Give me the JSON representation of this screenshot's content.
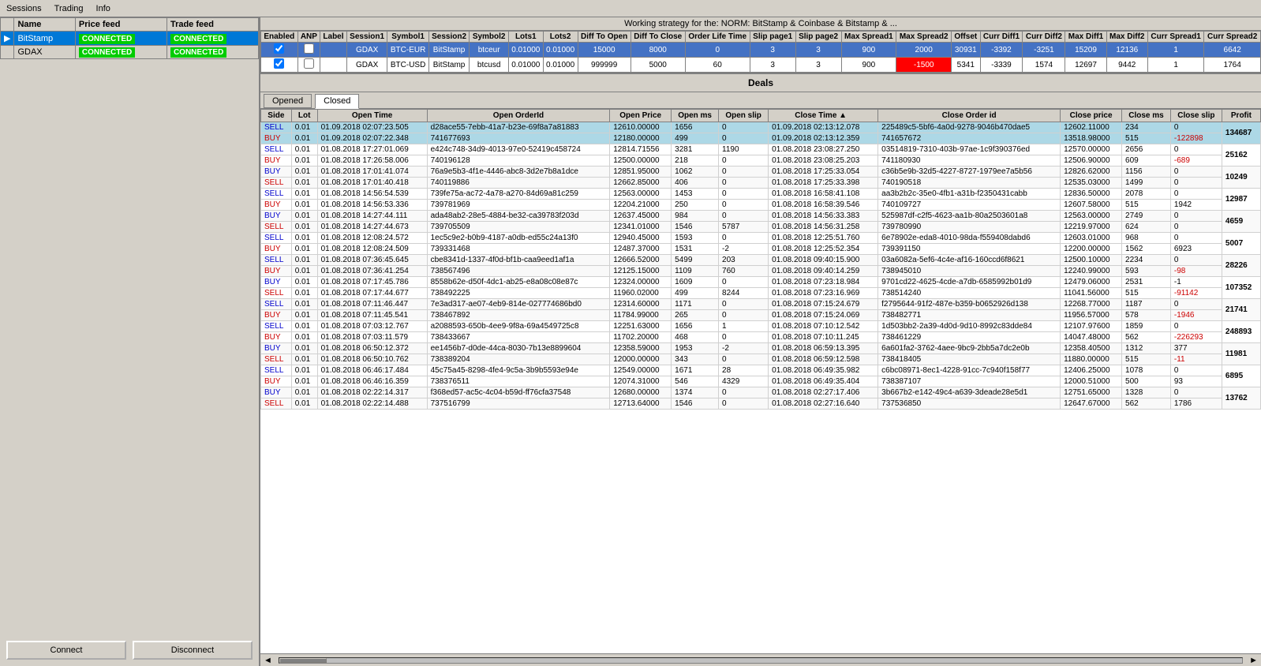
{
  "menu": {
    "items": [
      "Sessions",
      "Trading",
      "Info"
    ]
  },
  "title": "Working strategy for the: NORM: BitStamp & Coinbase & Bitstamp & ...",
  "leftPanel": {
    "columns": [
      "Name",
      "Price feed",
      "Trade feed"
    ],
    "rows": [
      {
        "name": "BitStamp",
        "priceFeed": "CONNECTED",
        "tradeFeed": "CONNECTED",
        "selected": true
      },
      {
        "name": "GDAX",
        "priceFeed": "CONNECTED",
        "tradeFeed": "CONNECTED",
        "selected": false
      }
    ],
    "connectBtn": "Connect",
    "disconnectBtn": "Disconnect"
  },
  "arbTable": {
    "columns": [
      "Enabled",
      "ANP",
      "Label",
      "Session1",
      "Symbol1",
      "Session2",
      "Symbol2",
      "Lots1",
      "Lots2",
      "Diff To Open",
      "Diff To Close",
      "Order Life Time",
      "Slip page1",
      "Slip page2",
      "Max Spread1",
      "Max Spread2",
      "Offset",
      "Curr Diff1",
      "Curr Diff2",
      "Max Diff1",
      "Max Diff2",
      "Curr Spread1",
      "Curr Spread2"
    ],
    "rows": [
      {
        "enabled": true,
        "anp": false,
        "label": "",
        "session1": "GDAX",
        "symbol1": "BTC-EUR",
        "session2": "BitStamp",
        "symbol2": "btceur",
        "lots1": "0.01000",
        "lots2": "0.01000",
        "diffOpen": "15000",
        "diffClose": "8000",
        "lifeTime": "0",
        "slip1": "3",
        "slip2": "3",
        "maxSpread1": "900",
        "maxSpread2": "2000",
        "offset": "30931",
        "currDiff1": "-3392",
        "currDiff2": "-3251",
        "maxDiff1": "15209",
        "maxDiff2": "12136",
        "currSpread1": "1",
        "currSpread2": "6642",
        "rowClass": "row-blue"
      },
      {
        "enabled": true,
        "anp": false,
        "label": "",
        "session1": "GDAX",
        "symbol1": "BTC-USD",
        "session2": "BitStamp",
        "symbol2": "btcusd",
        "lots1": "0.01000",
        "lots2": "0.01000",
        "diffOpen": "999999",
        "diffClose": "5000",
        "lifeTime": "60",
        "slip1": "3",
        "slip2": "3",
        "maxSpread1": "900",
        "maxSpread2": "-1500",
        "offset": "5341",
        "currDiff1": "-3339",
        "currDiff2": "1574",
        "maxDiff1": "12697",
        "maxDiff2": "9442",
        "currSpread1": "1",
        "currSpread2": "1764",
        "rowClass": "row-white",
        "redCell": "maxSpread2"
      }
    ]
  },
  "deals": {
    "title": "Deals",
    "tabs": [
      "Opened",
      "Closed"
    ],
    "activeTab": "Closed",
    "columns": [
      "Side",
      "Lot",
      "Open Time",
      "Open OrderId",
      "Open Price",
      "Open ms",
      "Open slip",
      "Close Time",
      "Close Order id",
      "Close price",
      "Close ms",
      "Close slip",
      "Profit"
    ],
    "rows": [
      {
        "side1": "SELL",
        "side2": "BUY",
        "lot1": "0.01",
        "lot2": "0.01",
        "openTime1": "01.09.2018 02:07:23.505",
        "openTime2": "01.09.2018 02:07:22.348",
        "orderId1": "d28ace55-7ebb-41a7-b23e-69f8a7a81883",
        "orderId2": "741677693",
        "openPrice1": "12610.00000",
        "openPrice2": "12180.00000",
        "openMs1": "1656",
        "openMs2": "499",
        "openSlip1": "0",
        "openSlip2": "0",
        "closeTime1": "01.09.2018 02:13:12.078",
        "closeTime2": "01.09.2018 02:13:12.359",
        "closeOrderId1": "225489c5-5bf6-4a0d-9278-9046b470dae5",
        "closeOrderId2": "741657672",
        "closePrice1": "12602.11000",
        "closePrice2": "13518.98000",
        "closeMs1": "234",
        "closeMs2": "515",
        "closeSlip1": "0",
        "closeSlip2": "-122898",
        "profit": "134687",
        "highlight": true
      },
      {
        "side1": "SELL",
        "side2": "BUY",
        "lot1": "0.01",
        "lot2": "0.01",
        "openTime1": "01.08.2018 17:27:01.069",
        "openTime2": "01.08.2018 17:26:58.006",
        "orderId1": "e424c748-34d9-4013-97e0-52419c458724",
        "orderId2": "740196128",
        "openPrice1": "12814.71556",
        "openPrice2": "12500.00000",
        "openMs1": "3281",
        "openMs2": "218",
        "openSlip1": "1190",
        "openSlip2": "0",
        "closeTime1": "01.08.2018 23:08:27.250",
        "closeTime2": "01.08.2018 23:08:25.203",
        "closeOrderId1": "03514819-7310-403b-97ae-1c9f390376ed",
        "closeOrderId2": "741180930",
        "closePrice1": "12570.00000",
        "closePrice2": "12506.90000",
        "closeMs1": "2656",
        "closeMs2": "609",
        "closeSlip1": "0",
        "closeSlip2": "-689",
        "profit": "25162",
        "highlight": false
      },
      {
        "side1": "BUY",
        "side2": "SELL",
        "lot1": "0.01",
        "lot2": "0.01",
        "openTime1": "01.08.2018 17:01:41.074",
        "openTime2": "01.08.2018 17:01:40.418",
        "orderId1": "76a9e5b3-4f1e-4446-abc8-3d2e7b8a1dce",
        "orderId2": "740119886",
        "openPrice1": "12851.95000",
        "openPrice2": "12662.85000",
        "openMs1": "1062",
        "openMs2": "406",
        "openSlip1": "0",
        "openSlip2": "0",
        "closeTime1": "01.08.2018 17:25:33.054",
        "closeTime2": "01.08.2018 17:25:33.398",
        "closeOrderId1": "c36b5e9b-32d5-4227-8727-1979ee7a5b56",
        "closeOrderId2": "740190518",
        "closePrice1": "12826.62000",
        "closePrice2": "12535.03000",
        "closeMs1": "1156",
        "closeMs2": "1499",
        "closeSlip1": "0",
        "closeSlip2": "0",
        "profit": "10249",
        "highlight": false
      },
      {
        "side1": "SELL",
        "side2": "BUY",
        "lot1": "0.01",
        "lot2": "0.01",
        "openTime1": "01.08.2018 14:56:54.539",
        "openTime2": "01.08.2018 14:56:53.336",
        "orderId1": "739fe75a-ac72-4a78-a270-84d69a81c259",
        "orderId2": "739781969",
        "openPrice1": "12563.00000",
        "openPrice2": "12204.21000",
        "openMs1": "1453",
        "openMs2": "250",
        "openSlip1": "0",
        "openSlip2": "0",
        "closeTime1": "01.08.2018 16:58:41.108",
        "closeTime2": "01.08.2018 16:58:39.546",
        "closeOrderId1": "aa3b2b2c-35e0-4fb1-a31b-f2350431cabb",
        "closeOrderId2": "740109727",
        "closePrice1": "12836.50000",
        "closePrice2": "12607.58000",
        "closeMs1": "2078",
        "closeMs2": "515",
        "closeSlip1": "0",
        "closeSlip2": "1942",
        "profit": "12987",
        "highlight": false
      },
      {
        "side1": "BUY",
        "side2": "SELL",
        "lot1": "0.01",
        "lot2": "0.01",
        "openTime1": "01.08.2018 14:27:44.111",
        "openTime2": "01.08.2018 14:27:44.673",
        "orderId1": "ada48ab2-28e5-4884-be32-ca39783f203d",
        "orderId2": "739705509",
        "openPrice1": "12637.45000",
        "openPrice2": "12341.01000",
        "openMs1": "984",
        "openMs2": "1546",
        "openSlip1": "0",
        "openSlip2": "5787",
        "closeTime1": "01.08.2018 14:56:33.383",
        "closeTime2": "01.08.2018 14:56:31.258",
        "closeOrderId1": "525987df-c2f5-4623-aa1b-80a2503601a8",
        "closeOrderId2": "739780990",
        "closePrice1": "12563.00000",
        "closePrice2": "12219.97000",
        "closeMs1": "2749",
        "closeMs2": "624",
        "closeSlip1": "0",
        "closeSlip2": "0",
        "profit": "4659",
        "highlight": false
      },
      {
        "side1": "SELL",
        "side2": "BUY",
        "lot1": "0.01",
        "lot2": "0.01",
        "openTime1": "01.08.2018 12:08:24.572",
        "openTime2": "01.08.2018 12:08:24.509",
        "orderId1": "1ec5c9e2-b0b9-4187-a0db-ed55c24a13f0",
        "orderId2": "739331468",
        "openPrice1": "12940.45000",
        "openPrice2": "12487.37000",
        "openMs1": "1593",
        "openMs2": "1531",
        "openSlip1": "0",
        "openSlip2": "-2",
        "closeTime1": "01.08.2018 12:25:51.760",
        "closeTime2": "01.08.2018 12:25:52.354",
        "closeOrderId1": "6e78902e-eda8-4010-98da-f559408dabd6",
        "closeOrderId2": "739391150",
        "closePrice1": "12603.01000",
        "closePrice2": "12200.00000",
        "closeMs1": "968",
        "closeMs2": "1562",
        "closeSlip1": "0",
        "closeSlip2": "6923",
        "profit": "5007",
        "highlight": false
      },
      {
        "side1": "SELL",
        "side2": "BUY",
        "lot1": "0.01",
        "lot2": "0.01",
        "openTime1": "01.08.2018 07:36:45.645",
        "openTime2": "01.08.2018 07:36:41.254",
        "orderId1": "cbe8341d-1337-4f0d-bf1b-caa9eed1af1a",
        "orderId2": "738567496",
        "openPrice1": "12666.52000",
        "openPrice2": "12125.15000",
        "openMs1": "5499",
        "openMs2": "1109",
        "openSlip1": "203",
        "openSlip2": "760",
        "closeTime1": "01.08.2018 09:40:15.900",
        "closeTime2": "01.08.2018 09:40:14.259",
        "closeOrderId1": "03a6082a-5ef6-4c4e-af16-160ccd6f8621",
        "closeOrderId2": "738945010",
        "closePrice1": "12500.10000",
        "closePrice2": "12240.99000",
        "closeMs1": "2234",
        "closeMs2": "593",
        "closeSlip1": "0",
        "closeSlip2": "-98",
        "profit": "28226",
        "highlight": false
      },
      {
        "side1": "BUY",
        "side2": "SELL",
        "lot1": "0.01",
        "lot2": "0.01",
        "openTime1": "01.08.2018 07:17:45.786",
        "openTime2": "01.08.2018 07:17:44.677",
        "orderId1": "8558b62e-d50f-4dc1-ab25-e8a08c08e87c",
        "orderId2": "738492225",
        "openPrice1": "12324.00000",
        "openPrice2": "11960.02000",
        "openMs1": "1609",
        "openMs2": "499",
        "openSlip1": "0",
        "openSlip2": "8244",
        "closeTime1": "01.08.2018 07:23:18.984",
        "closeTime2": "01.08.2018 07:23:16.969",
        "closeOrderId1": "9701cd22-4625-4cde-a7db-6585992b01d9",
        "closeOrderId2": "738514240",
        "closePrice1": "12479.06000",
        "closePrice2": "11041.56000",
        "closeMs1": "2531",
        "closeMs2": "515",
        "closeSlip1": "-1",
        "closeSlip2": "-91142",
        "profit": "107352",
        "highlight": false
      },
      {
        "side1": "SELL",
        "side2": "BUY",
        "lot1": "0.01",
        "lot2": "0.01",
        "openTime1": "01.08.2018 07:11:46.447",
        "openTime2": "01.08.2018 07:11:45.541",
        "orderId1": "7e3ad317-ae07-4eb9-814e-027774686bd0",
        "orderId2": "738467892",
        "openPrice1": "12314.60000",
        "openPrice2": "11784.99000",
        "openMs1": "1171",
        "openMs2": "265",
        "openSlip1": "0",
        "openSlip2": "0",
        "closeTime1": "01.08.2018 07:15:24.679",
        "closeTime2": "01.08.2018 07:15:24.069",
        "closeOrderId1": "f2795644-91f2-487e-b359-b0652926d138",
        "closeOrderId2": "738482771",
        "closePrice1": "12268.77000",
        "closePrice2": "11956.57000",
        "closeMs1": "1187",
        "closeMs2": "578",
        "closeSlip1": "0",
        "closeSlip2": "-1946",
        "profit": "21741",
        "highlight": false
      },
      {
        "side1": "SELL",
        "side2": "BUY",
        "lot1": "0.01",
        "lot2": "0.01",
        "openTime1": "01.08.2018 07:03:12.767",
        "openTime2": "01.08.2018 07:03:11.579",
        "orderId1": "a2088593-650b-4ee9-9f8a-69a4549725c8",
        "orderId2": "738433667",
        "openPrice1": "12251.63000",
        "openPrice2": "11702.20000",
        "openMs1": "1656",
        "openMs2": "468",
        "openSlip1": "1",
        "openSlip2": "0",
        "closeTime1": "01.08.2018 07:10:12.542",
        "closeTime2": "01.08.2018 07:10:11.245",
        "closeOrderId1": "1d503bb2-2a39-4d0d-9d10-8992c83dde84",
        "closeOrderId2": "738461229",
        "closePrice1": "12107.97600",
        "closePrice2": "14047.48000",
        "closeMs1": "1859",
        "closeMs2": "562",
        "closeSlip1": "0",
        "closeSlip2": "-226293",
        "profit": "248893",
        "highlight": false
      },
      {
        "side1": "BUY",
        "side2": "SELL",
        "lot1": "0.01",
        "lot2": "0.01",
        "openTime1": "01.08.2018 06:50:12.372",
        "openTime2": "01.08.2018 06:50:10.762",
        "orderId1": "ee1456b7-d0de-44ca-8030-7b13e8899604",
        "orderId2": "738389204",
        "openPrice1": "12358.59000",
        "openPrice2": "12000.00000",
        "openMs1": "1953",
        "openMs2": "343",
        "openSlip1": "-2",
        "openSlip2": "0",
        "closeTime1": "01.08.2018 06:59:13.395",
        "closeTime2": "01.08.2018 06:59:12.598",
        "closeOrderId1": "6a601fa2-3762-4aee-9bc9-2bb5a7dc2e0b",
        "closeOrderId2": "738418405",
        "closePrice1": "12358.40500",
        "closePrice2": "11880.00000",
        "closeMs1": "1312",
        "closeMs2": "515",
        "closeSlip1": "377",
        "closeSlip2": "-11",
        "profit": "11981",
        "highlight": false
      },
      {
        "side1": "SELL",
        "side2": "BUY",
        "lot1": "0.01",
        "lot2": "0.01",
        "openTime1": "01.08.2018 06:46:17.484",
        "openTime2": "01.08.2018 06:46:16.359",
        "orderId1": "45c75a45-8298-4fe4-9c5a-3b9b5593e94e",
        "orderId2": "738376511",
        "openPrice1": "12549.00000",
        "openPrice2": "12074.31000",
        "openMs1": "1671",
        "openMs2": "546",
        "openSlip1": "28",
        "openSlip2": "4329",
        "closeTime1": "01.08.2018 06:49:35.982",
        "closeTime2": "01.08.2018 06:49:35.404",
        "closeOrderId1": "c6bc08971-8ec1-4228-91cc-7c940f158f77",
        "closeOrderId2": "738387107",
        "closePrice1": "12406.25000",
        "closePrice2": "12000.51000",
        "closeMs1": "1078",
        "closeMs2": "500",
        "closeSlip1": "0",
        "closeSlip2": "93",
        "profit": "6895",
        "highlight": false
      },
      {
        "side1": "BUY",
        "side2": "SELL",
        "lot1": "0.01",
        "lot2": "0.01",
        "openTime1": "01.08.2018 02:22:14.317",
        "openTime2": "01.08.2018 02:22:14.488",
        "orderId1": "f368ed57-ac5c-4c04-b59d-ff76cfa37548",
        "orderId2": "737516799",
        "openPrice1": "12680.00000",
        "openPrice2": "12713.64000",
        "openMs1": "1374",
        "openMs2": "1546",
        "openSlip1": "0",
        "openSlip2": "0",
        "closeTime1": "01.08.2018 02:27:17.406",
        "closeTime2": "01.08.2018 02:27:16.640",
        "closeOrderId1": "3b667b2-e142-49c4-a639-3deade28e5d1",
        "closeOrderId2": "737536850",
        "closePrice1": "12751.65000",
        "closePrice2": "12647.67000",
        "closeMs1": "1328",
        "closeMs2": "562",
        "closeSlip1": "0",
        "closeSlip2": "1786",
        "profit": "13762",
        "highlight": false
      }
    ]
  }
}
